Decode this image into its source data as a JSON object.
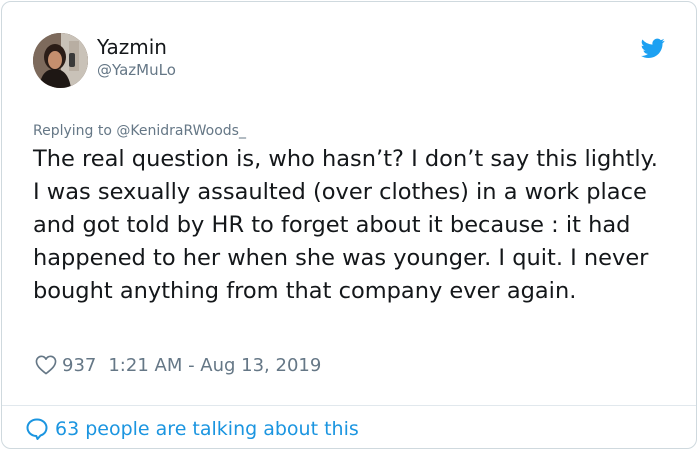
{
  "user": {
    "display_name": "Yazmin",
    "handle": "@YazMuLo"
  },
  "reply_context": "Replying to @KenidraRWoods_",
  "tweet_text": "The real question is, who hasn’t? I don’t say this lightly. I was sexually assaulted (over clothes) in a work place and got told by HR to forget about it because : it had happened to her when she was younger. I quit. I never bought anything from that company ever again.",
  "meta": {
    "like_count": "937",
    "timestamp": "1:21 AM - Aug 13, 2019"
  },
  "footer": {
    "talking_label": "63 people are talking about this"
  },
  "icons": {
    "brand": "twitter-bird-icon",
    "like": "heart-outline-icon",
    "conversation": "speech-bubble-icon"
  },
  "colors": {
    "twitter_blue": "#1da1f2",
    "link_blue": "#1b95e0",
    "text_primary": "#14171a",
    "text_secondary": "#657786",
    "border": "#cfd9de"
  }
}
